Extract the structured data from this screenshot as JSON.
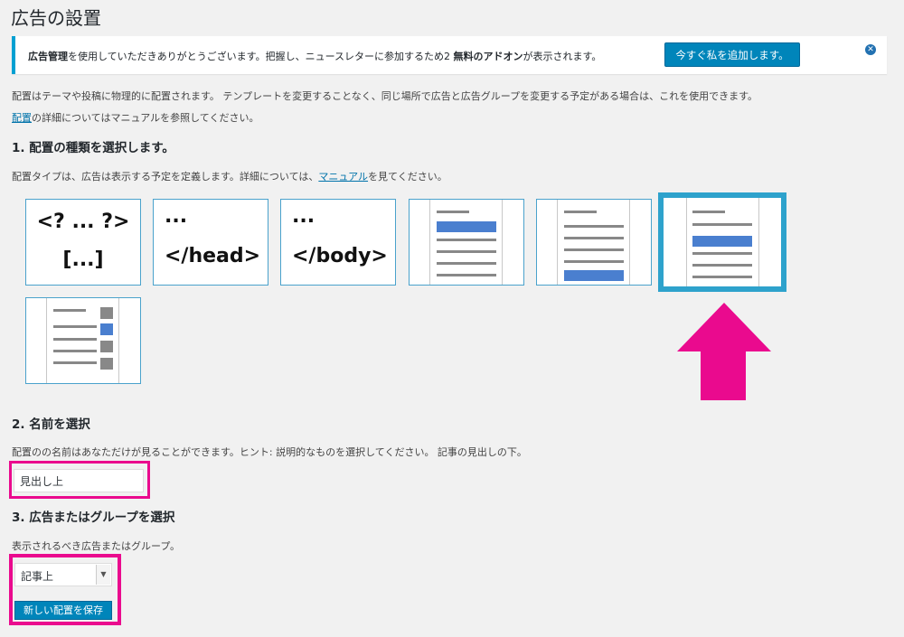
{
  "page": {
    "title": "広告の設置"
  },
  "notice": {
    "text_bold1": "広告管理",
    "text_mid": "を使用していただきありがとうございます。把握し、ニュースレターに参加するため2 ",
    "text_bold2": "無料のアドオン",
    "text_end": "が表示されます。",
    "button_label": "今すぐ私を追加します。",
    "close_glyph": "✕"
  },
  "intro": {
    "line1": "配置はテーマや投稿に物理的に配置されます。 テンプレートを変更することなく、同じ場所で広告と広告グループを変更する予定がある場合は、これを使用できます。",
    "link_text": "配置",
    "line2_rest": "の詳細についてはマニュアルを参照してください。"
  },
  "step1": {
    "heading": "1. 配置の種類を選択します。",
    "desc_before": "配置タイプは、広告は表示する予定を定義します。詳細については、",
    "desc_link": "マニュアル",
    "desc_after": "を見てください。",
    "types": [
      {
        "line1": "<? ... ?>",
        "line2": "[...]"
      },
      {
        "line1": "...",
        "line2": "</head>"
      },
      {
        "line1": "...",
        "line2": "</body>"
      }
    ]
  },
  "step2": {
    "heading": "2. 名前を選択",
    "desc": "配置のの名前はあなただけが見ることができます。ヒント: 説明的なものを選択してください。 記事の見出しの下。",
    "input_value": "見出し上"
  },
  "step3": {
    "heading": "3. 広告またはグループを選択",
    "desc": "表示されるべき広告またはグループ。",
    "select_value": "記事上",
    "save_label": "新しい配置を保存"
  },
  "colors": {
    "accent": "#0085ba",
    "highlight": "#ea0a8e",
    "selected_border": "#2ea2cc",
    "content_blue": "#4a7fcf"
  }
}
